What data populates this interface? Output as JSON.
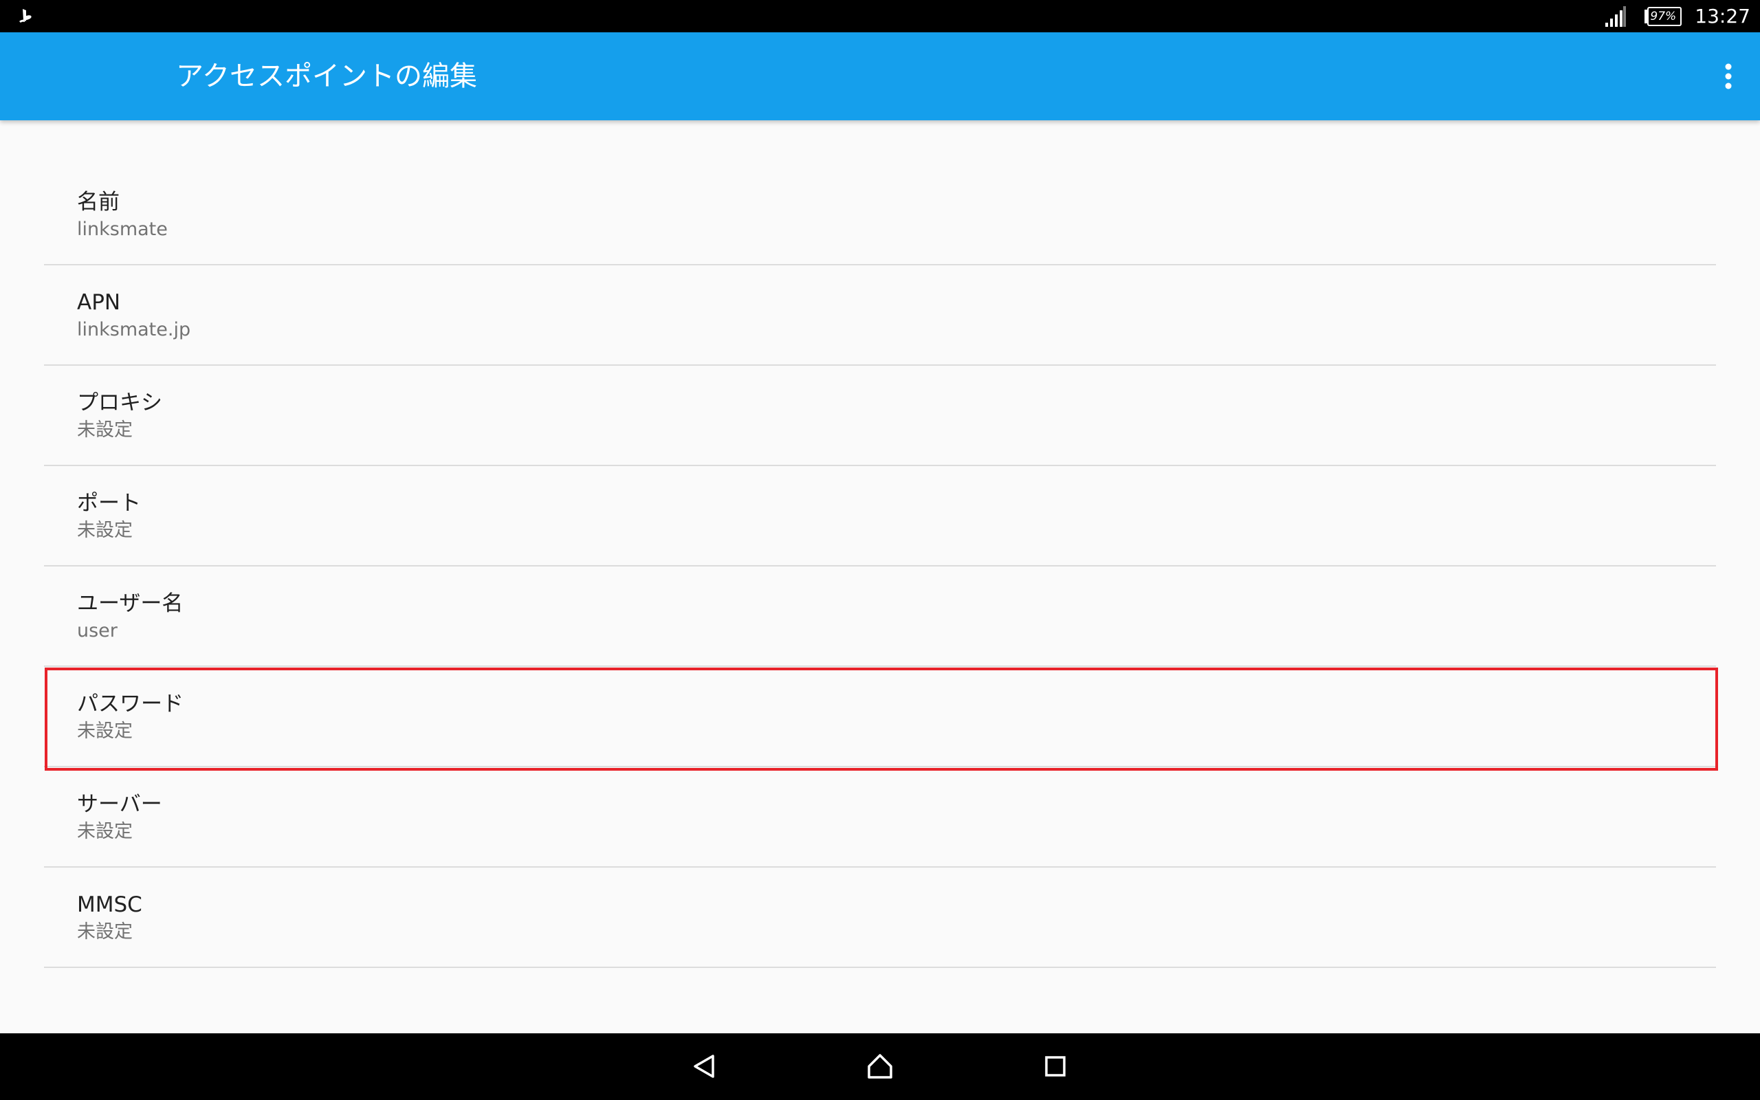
{
  "status_bar": {
    "battery": "97%",
    "time": "13:27"
  },
  "app_bar": {
    "title": "アクセスポイントの編集"
  },
  "preferences": [
    {
      "title": "名前",
      "summary": "linksmate"
    },
    {
      "title": "APN",
      "summary": "linksmate.jp"
    },
    {
      "title": "プロキシ",
      "summary": "未設定"
    },
    {
      "title": "ポート",
      "summary": "未設定"
    },
    {
      "title": "ユーザー名",
      "summary": "user"
    },
    {
      "title": "パスワード",
      "summary": "未設定"
    },
    {
      "title": "サーバー",
      "summary": "未設定"
    },
    {
      "title": "MMSC",
      "summary": "未設定"
    }
  ],
  "icons": {
    "status_left": "playstation-notification-icon",
    "signal": "cellular-signal-icon",
    "battery": "battery-icon",
    "overflow": "more-vert-icon",
    "back": "back-triangle-icon",
    "home": "home-icon",
    "recents": "recents-square-icon"
  },
  "colors": {
    "app_bar": "#159fec",
    "highlight": "#e8232a",
    "background": "#fafafa"
  }
}
